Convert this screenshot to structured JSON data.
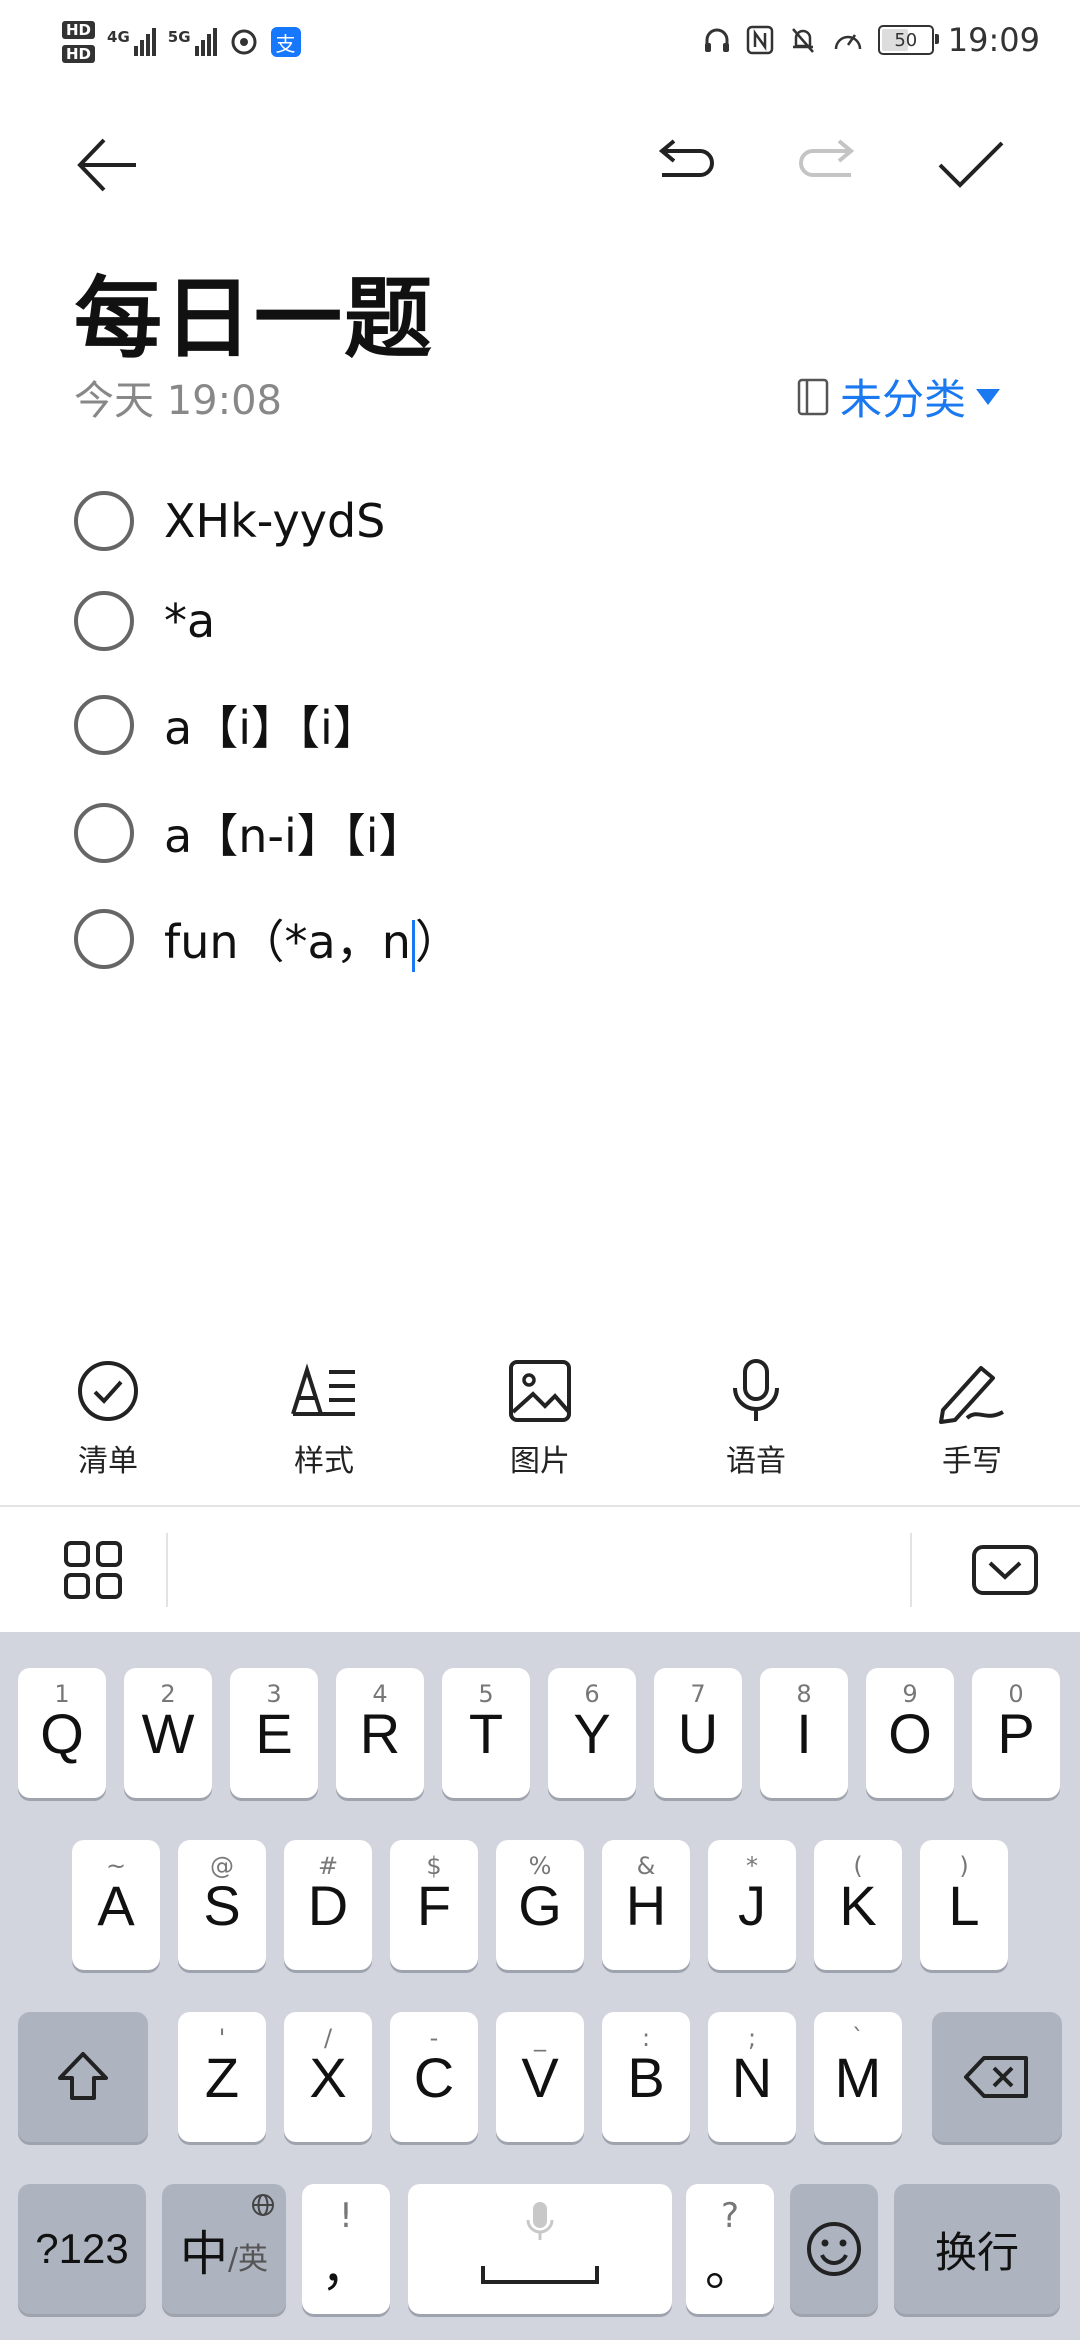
{
  "status_bar": {
    "hd1": "HD",
    "hd2": "HD",
    "net1": "4G",
    "net2": "5G",
    "time": "19:09",
    "battery": "50"
  },
  "toolbar": {
    "back_icon": "arrow-left-icon",
    "undo_icon": "undo-icon",
    "redo_icon": "redo-icon",
    "done_icon": "checkmark-icon"
  },
  "note": {
    "title": "每日一题",
    "date": "今天 19:08",
    "category": "未分类"
  },
  "checklist": [
    {
      "text": "XHk-yydS",
      "checked": false
    },
    {
      "text": "*a",
      "checked": false
    },
    {
      "text": "a【i】【i】",
      "checked": false
    },
    {
      "text": "a【n-i】【i】",
      "checked": false
    },
    {
      "text_before_caret": "fun（*a，n",
      "text_after_caret": "）",
      "checked": false
    }
  ],
  "edit_tools": [
    {
      "label": "清单",
      "icon": "checklist-icon"
    },
    {
      "label": "样式",
      "icon": "text-style-icon"
    },
    {
      "label": "图片",
      "icon": "image-icon"
    },
    {
      "label": "语音",
      "icon": "microphone-icon"
    },
    {
      "label": "手写",
      "icon": "pen-icon"
    }
  ],
  "keyboard": {
    "row1": [
      {
        "main": "Q",
        "sub": "1"
      },
      {
        "main": "W",
        "sub": "2"
      },
      {
        "main": "E",
        "sub": "3"
      },
      {
        "main": "R",
        "sub": "4"
      },
      {
        "main": "T",
        "sub": "5"
      },
      {
        "main": "Y",
        "sub": "6"
      },
      {
        "main": "U",
        "sub": "7"
      },
      {
        "main": "I",
        "sub": "8"
      },
      {
        "main": "O",
        "sub": "9"
      },
      {
        "main": "P",
        "sub": "0"
      }
    ],
    "row2": [
      {
        "main": "A",
        "sub": "~"
      },
      {
        "main": "S",
        "sub": "@"
      },
      {
        "main": "D",
        "sub": "#"
      },
      {
        "main": "F",
        "sub": "$"
      },
      {
        "main": "G",
        "sub": "%"
      },
      {
        "main": "H",
        "sub": "&"
      },
      {
        "main": "J",
        "sub": "*"
      },
      {
        "main": "K",
        "sub": "("
      },
      {
        "main": "L",
        "sub": ")"
      }
    ],
    "row3": [
      {
        "main": "Z",
        "sub": "'"
      },
      {
        "main": "X",
        "sub": "/"
      },
      {
        "main": "C",
        "sub": "-"
      },
      {
        "main": "V",
        "sub": "_"
      },
      {
        "main": "B",
        "sub": ":"
      },
      {
        "main": "N",
        "sub": ";"
      },
      {
        "main": "M",
        "sub": "`"
      }
    ],
    "numbers_key": "?123",
    "lang_key_main": "中",
    "lang_key_sub": "/英",
    "comma_key_main": "，",
    "comma_key_sub": "!",
    "period_key_main": "。",
    "period_key_sub": "?",
    "enter_key": "换行"
  },
  "colors": {
    "accent": "#1a78f0",
    "keyboard_bg": "#d2d5dd",
    "func_key": "#adb4c0"
  }
}
